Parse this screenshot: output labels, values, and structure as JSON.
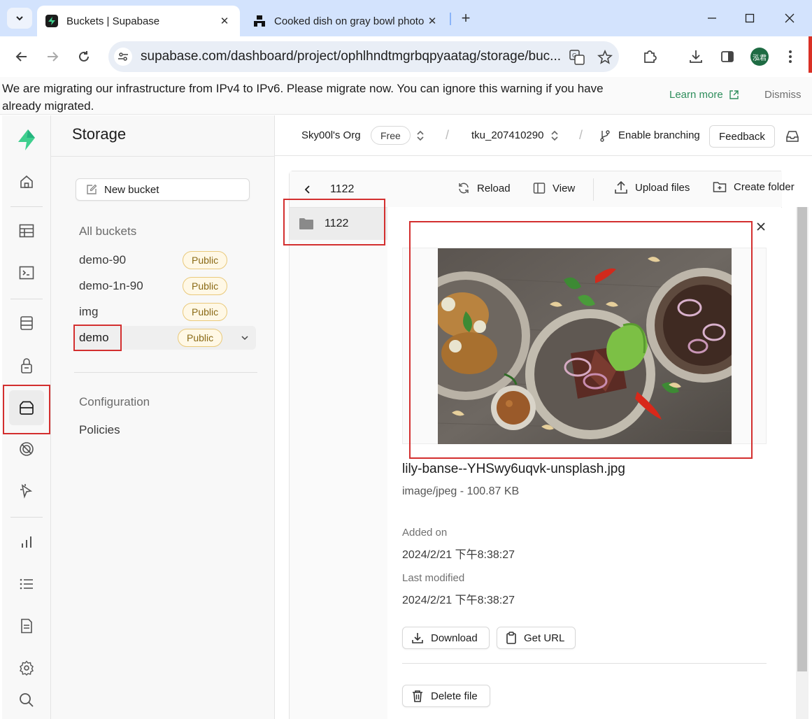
{
  "browser": {
    "tabs": [
      {
        "title": "Buckets | Supabase",
        "active": true
      },
      {
        "title": "Cooked dish on gray bowl photo",
        "active": false
      }
    ],
    "url": "supabase.com/dashboard/project/ophlhndtmgrbqpyaatag/storage/buc...",
    "avatar_text": "泓君"
  },
  "banner": {
    "message": "We are migrating our infrastructure from IPv4 to IPv6. Please migrate now. You can ignore this warning if you have already migrated.",
    "learn_more": "Learn more",
    "dismiss": "Dismiss"
  },
  "storage_menu": {
    "title": "Storage",
    "new_bucket": "New bucket",
    "all_buckets_label": "All buckets",
    "buckets": [
      {
        "name": "demo-90",
        "badge": "Public"
      },
      {
        "name": "demo-1n-90",
        "badge": "Public"
      },
      {
        "name": "img",
        "badge": "Public"
      },
      {
        "name": "demo",
        "badge": "Public",
        "selected": true
      }
    ],
    "configuration_label": "Configuration",
    "policies": "Policies"
  },
  "topbar": {
    "org": "Sky00l's Org",
    "plan": "Free",
    "project": "tku_207410290",
    "enable_branching": "Enable branching",
    "feedback": "Feedback"
  },
  "explorer": {
    "path": "1122",
    "reload": "Reload",
    "view": "View",
    "upload": "Upload files",
    "create_folder": "Create folder",
    "folder": "1122"
  },
  "preview": {
    "file_name": "lily-banse--YHSwy6uqvk-unsplash.jpg",
    "file_meta": "image/jpeg - 100.87 KB",
    "added_on_label": "Added on",
    "added_on": "2024/2/21 下午8:38:27",
    "last_modified_label": "Last modified",
    "last_modified": "2024/2/21 下午8:38:27",
    "download": "Download",
    "get_url": "Get URL",
    "delete_file": "Delete file"
  },
  "colors": {
    "brand": "#3ecf8e",
    "badge_border": "#e9c97b",
    "highlight": "#d32f2f"
  }
}
